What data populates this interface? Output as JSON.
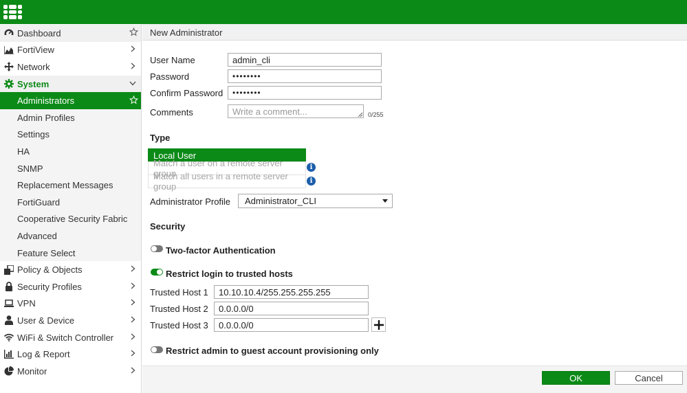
{
  "colors": {
    "brand": "#0c8a17",
    "info": "#1b5eab"
  },
  "sidebar": {
    "items": [
      {
        "label": "Dashboard",
        "icon": "dashboard-icon",
        "trail": "star-icon"
      },
      {
        "label": "FortiView",
        "icon": "fortiview-icon",
        "trail": "chevron-right-icon"
      },
      {
        "label": "Network",
        "icon": "network-icon",
        "trail": "chevron-right-icon"
      },
      {
        "label": "System",
        "icon": "gear-icon",
        "trail": "chevron-down-icon"
      },
      {
        "label": "Administrators",
        "trail": "star-icon"
      },
      {
        "label": "Admin Profiles"
      },
      {
        "label": "Settings"
      },
      {
        "label": "HA"
      },
      {
        "label": "SNMP"
      },
      {
        "label": "Replacement Messages"
      },
      {
        "label": "FortiGuard"
      },
      {
        "label": "Cooperative Security Fabric"
      },
      {
        "label": "Advanced"
      },
      {
        "label": "Feature Select"
      },
      {
        "label": "Policy & Objects",
        "icon": "policy-icon",
        "trail": "chevron-right-icon"
      },
      {
        "label": "Security Profiles",
        "icon": "lock-icon",
        "trail": "chevron-right-icon"
      },
      {
        "label": "VPN",
        "icon": "laptop-icon",
        "trail": "chevron-right-icon"
      },
      {
        "label": "User & Device",
        "icon": "user-icon",
        "trail": "chevron-right-icon"
      },
      {
        "label": "WiFi & Switch Controller",
        "icon": "wifi-icon",
        "trail": "chevron-right-icon"
      },
      {
        "label": "Log & Report",
        "icon": "bar-chart-icon",
        "trail": "chevron-right-icon"
      },
      {
        "label": "Monitor",
        "icon": "pie-chart-icon",
        "trail": "chevron-right-icon"
      }
    ]
  },
  "page": {
    "title": "New Administrator"
  },
  "form": {
    "username_label": "User Name",
    "username_value": "admin_cli",
    "password_label": "Password",
    "password_value": "••••••••",
    "confirm_label": "Confirm Password",
    "confirm_value": "••••••••",
    "comments_label": "Comments",
    "comments_placeholder": "Write a comment...",
    "comments_counter": "0/255",
    "type_heading": "Type",
    "type_options": [
      "Local User",
      "Match a user on a remote server group",
      "Match all users in a remote server group"
    ],
    "profile_label": "Administrator Profile",
    "profile_value": "Administrator_CLI",
    "security_heading": "Security",
    "two_factor_label": "Two-factor Authentication",
    "two_factor_on": false,
    "restrict_label": "Restrict login to trusted hosts",
    "restrict_on": true,
    "hosts": [
      {
        "label": "Trusted Host 1",
        "value": "10.10.10.4/255.255.255.255"
      },
      {
        "label": "Trusted Host 2",
        "value": "0.0.0.0/0"
      },
      {
        "label": "Trusted Host 3",
        "value": "0.0.0.0/0"
      }
    ],
    "guest_label": "Restrict admin to guest account provisioning only",
    "guest_on": false
  },
  "footer": {
    "ok_label": "OK",
    "cancel_label": "Cancel"
  }
}
